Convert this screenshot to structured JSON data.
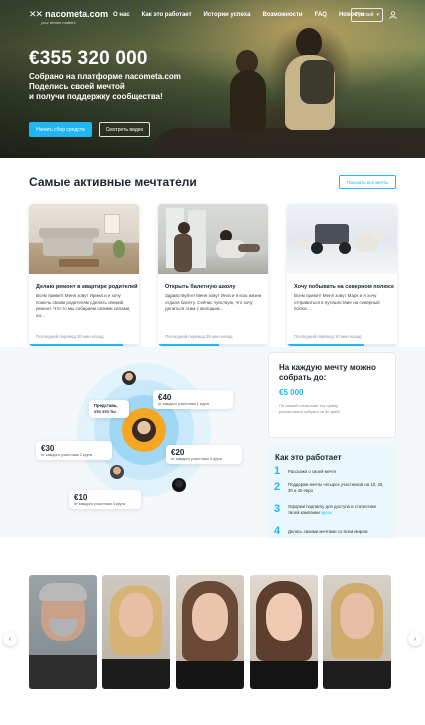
{
  "header": {
    "logo_text": "nacometa.com",
    "logo_tagline": "your dream matters",
    "nav": [
      "О нас",
      "Как это работает",
      "Истории успеха",
      "Возможности",
      "FAQ",
      "Новости"
    ],
    "language": "Русский"
  },
  "hero": {
    "amount": "€355 320 000",
    "subtitle_line1": "Собрано на платформе nacometa.com",
    "subtitle_line2": "Поделись своей мечтой",
    "subtitle_line3": "и получи поддержку сообщества!",
    "primary_button": "Начать сбор средств",
    "secondary_button": "Смотреть видео"
  },
  "dreamers": {
    "title": "Самые активные мечтатели",
    "see_all": "Показать все мечты",
    "cards": [
      {
        "title": "Делаю ремонт в квартире родителей",
        "text": "Всем привет! Меня зовут Ирина и я хочу помочь своим родителям сделать свежий ремонт. Что-то мы собираем своими силами, но...",
        "last_transfer": "Последний перевод 20 мин назад",
        "progress": 0.85
      },
      {
        "title": "Открыть балетную школу",
        "text": "Здравствуйте! Меня зовут Инга и я всю жизни отдала балету. Сейчас чувствую, что хочу делиться этим с молодым...",
        "last_transfer": "Последний перевод 35 мин назад",
        "progress": 0.55
      },
      {
        "title": "Хочу побывать на северном полюсе",
        "text": "Всем привет! Меня зовут Марк и я хочу отправиться в путешествие на северный полюс...",
        "last_transfer": "Последний перевод 10 мин назад",
        "progress": 0.7
      }
    ]
  },
  "circle": {
    "center_label": "Представь, что это ты",
    "rewards": [
      {
        "amount": "€40",
        "label": "от каждого участника 1 круга"
      },
      {
        "amount": "€30",
        "label": "от каждого участника 2 круга"
      },
      {
        "amount": "€20",
        "label": "от каждого участника 3 круга"
      },
      {
        "amount": "€10",
        "label": "от каждого участника 4 круга"
      }
    ]
  },
  "info_box": {
    "heading": "На каждую мечту можно собрать до:",
    "value": "€5 000",
    "note": "По нашей статистике эту сумму реалистично собрать за 30 дней"
  },
  "how_it_works": {
    "title": "Как это работает",
    "steps": [
      {
        "num": "1",
        "text": "Расскажи о своей мечте"
      },
      {
        "num": "2",
        "text": "Поддержи мечты четырех участников на 10, 20, 30 и 40 евро"
      },
      {
        "num": "3",
        "text_before": "Оформи подписку для доступа и статистике твоей кампании ",
        "link": "здесь"
      },
      {
        "num": "4",
        "text": "Делись своими мечтами со всем миром"
      }
    ]
  },
  "colors": {
    "accent": "#1fb6f2",
    "orange": "#f5a623",
    "dark_text": "#1b2430"
  }
}
